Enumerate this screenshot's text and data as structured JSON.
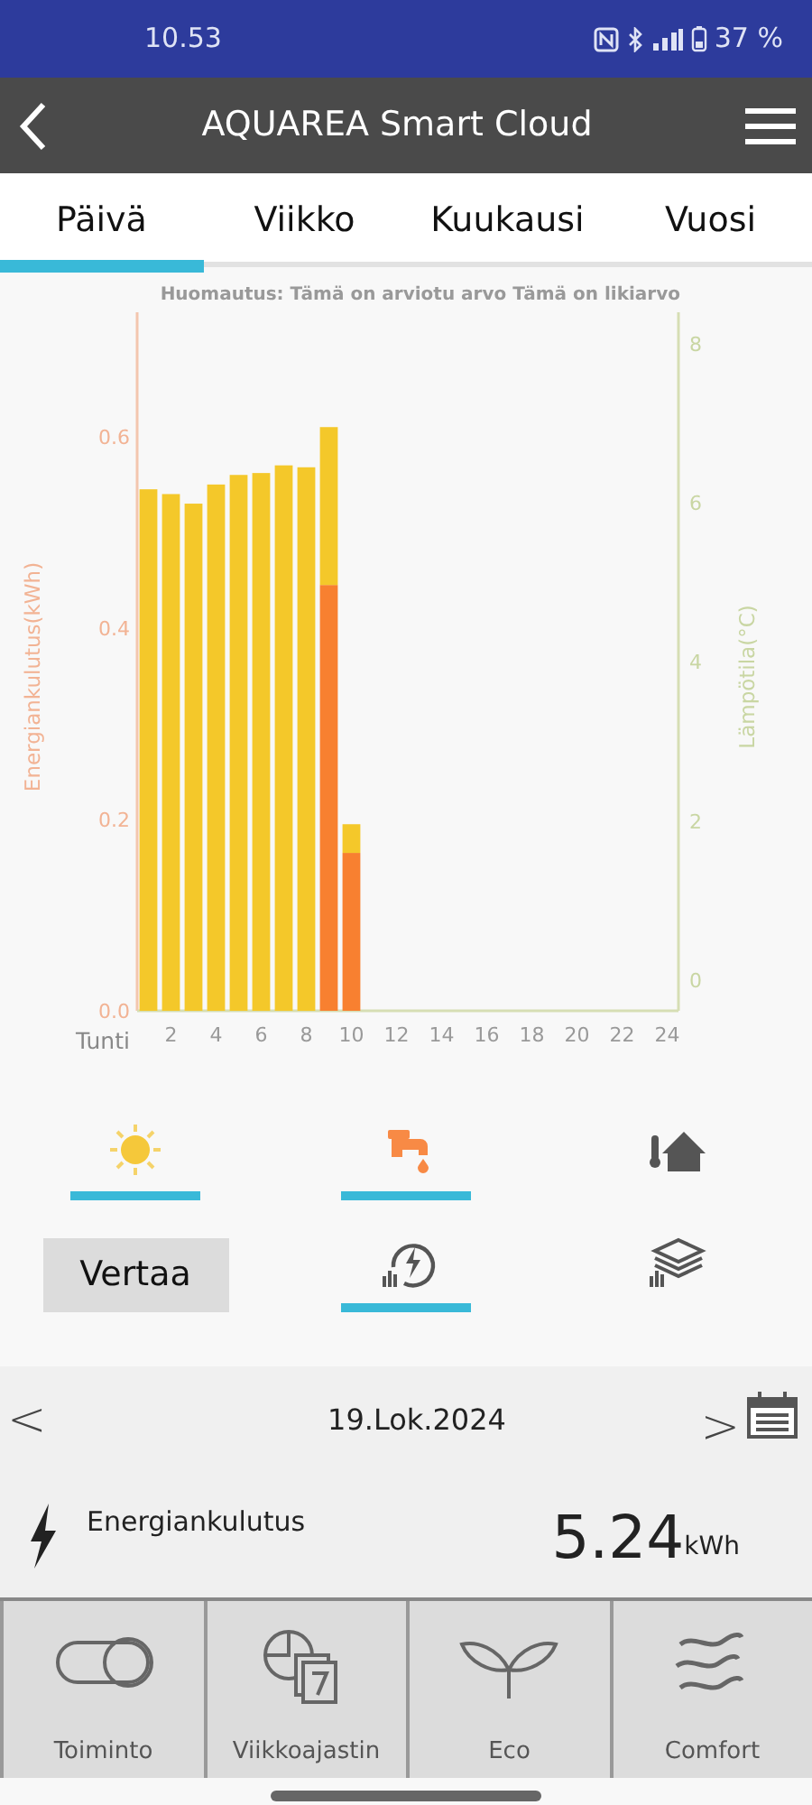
{
  "status_bar": {
    "time": "10.53",
    "battery": "37 %"
  },
  "header": {
    "title": "AQUAREA Smart Cloud"
  },
  "tabs": [
    {
      "label": "Päivä",
      "selected": true
    },
    {
      "label": "Viikko",
      "selected": false
    },
    {
      "label": "Kuukausi",
      "selected": false
    },
    {
      "label": "Vuosi",
      "selected": false
    }
  ],
  "chart": {
    "note": "Huomautus: Tämä on arviotu arvo Tämä on likiarvo",
    "chart_data": {
      "type": "bar",
      "stacked": true,
      "xlabel": "Tunti",
      "ylabel": "Energiankulutus(kWh)",
      "y2label": "Lämpötila(°C)",
      "x": [
        1,
        2,
        3,
        4,
        5,
        6,
        7,
        8,
        9,
        10
      ],
      "xlim": [
        0.5,
        24.5
      ],
      "xticks": [
        {
          "value": 2,
          "label": "2"
        },
        {
          "value": 4,
          "label": "4"
        },
        {
          "value": 6,
          "label": "6"
        },
        {
          "value": 8,
          "label": "8"
        },
        {
          "value": 10,
          "label": "10"
        },
        {
          "value": 12,
          "label": "12"
        },
        {
          "value": 14,
          "label": "14"
        },
        {
          "value": 16,
          "label": "16"
        },
        {
          "value": 18,
          "label": "18"
        },
        {
          "value": 20,
          "label": "20"
        },
        {
          "value": 22,
          "label": "22"
        },
        {
          "value": 24,
          "label": "24"
        }
      ],
      "ylim": [
        0,
        0.73
      ],
      "yticks": [
        {
          "value": 0,
          "label": "0.0"
        },
        {
          "value": 0.2,
          "label": "0.2"
        },
        {
          "value": 0.4,
          "label": "0.4"
        },
        {
          "value": 0.6,
          "label": "0.6"
        }
      ],
      "y2lim": [
        -0.39,
        8.4
      ],
      "y2ticks": [
        {
          "value": 0,
          "label": "0"
        },
        {
          "value": 2,
          "label": "2"
        },
        {
          "value": 4,
          "label": "4"
        },
        {
          "value": 6,
          "label": "6"
        },
        {
          "value": 8,
          "label": "8"
        }
      ],
      "series": [
        {
          "color": "#f88030",
          "values": [
            0,
            0,
            0,
            0,
            0,
            0,
            0,
            0,
            0.445,
            0.165
          ]
        },
        {
          "color": "#f4c82a",
          "values": [
            0.545,
            0.54,
            0.53,
            0.55,
            0.56,
            0.562,
            0.57,
            0.568,
            0.165,
            0.03
          ]
        }
      ]
    }
  },
  "mode_filters": [
    {
      "selected": true
    },
    {
      "selected": true
    },
    {
      "selected": false
    }
  ],
  "compare_button": {
    "label": "Vertaa"
  },
  "view_toggles": [
    {
      "selected": true
    },
    {
      "selected": false
    }
  ],
  "date_nav": {
    "prev": "<",
    "date": "19.Lok.2024",
    "next": ">"
  },
  "summary": {
    "label": "Energiankulutus",
    "value": "5.24",
    "unit": "kWh"
  },
  "bottom_nav": [
    {
      "label": "Toiminto"
    },
    {
      "label": "Viikkoajastin"
    },
    {
      "label": "Eco"
    },
    {
      "label": "Comfort"
    }
  ]
}
